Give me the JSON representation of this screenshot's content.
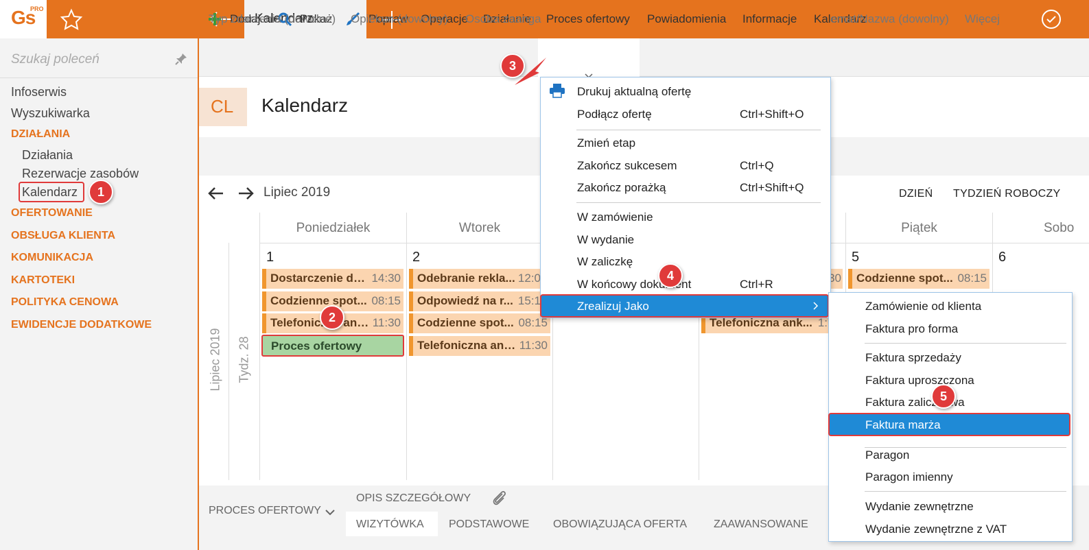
{
  "app": {
    "logo": "Gs",
    "logo_badge": "PRO",
    "active_tab": "Kalendarz"
  },
  "sidebar": {
    "search_placeholder": "Szukaj poleceń",
    "items": [
      {
        "label": "Infoserwis"
      },
      {
        "label": "Wyszukiwarka"
      }
    ],
    "groups": [
      {
        "label": "DZIAŁANIA"
      },
      {
        "label": "OFERTOWANIE"
      },
      {
        "label": "OBSŁUGA KLIENTA"
      },
      {
        "label": "KOMUNIKACJA"
      },
      {
        "label": "KARTOTEKI"
      },
      {
        "label": "POLITYKA CENOWA"
      },
      {
        "label": "EWIDENCJE DODATKOWE"
      }
    ],
    "subitems": [
      {
        "label": "Działania"
      },
      {
        "label": "Rezerwacje zasobów"
      },
      {
        "label": "Kalendarz"
      }
    ]
  },
  "toolbar": {
    "add": "Dodaj",
    "show": "Pokaż",
    "edit": "Popraw",
    "operations": "Operacje",
    "actions": "Działanie",
    "offer_process": "Proces ofertowy",
    "notifications": "Powiadomienia",
    "info": "Informacje",
    "calendar": "Kalendarz"
  },
  "page": {
    "badge": "CL",
    "title": "Kalendarz"
  },
  "filters": [
    "Typ zdarzenia (dowolne)",
    "Opiekun (dowolny)",
    "Osoba zaanga",
    "emat/Nazwa (dowolny)",
    "Więcej"
  ],
  "calendar": {
    "month": "Lipiec 2019",
    "view_day": "DZIEŃ",
    "view_workweek": "TYDZIEŃ ROBOCZY",
    "side_month": "Lipiec 2019",
    "side_week": "Tydz. 28",
    "days": [
      {
        "name": "Poniedziałek",
        "num": "1"
      },
      {
        "name": "Wtorek",
        "num": "2"
      },
      {
        "name": "Piątek",
        "num": "5"
      },
      {
        "name": "Sobo",
        "num": "6"
      }
    ],
    "monday_events": [
      {
        "title": "Dostarczenie du...",
        "time": "14:30"
      },
      {
        "title": "Codzienne spot...",
        "time": "08:15"
      },
      {
        "title": "Telefoniczna ank...",
        "time": "11:30"
      }
    ],
    "monday_selected_event": "Proces ofertowy",
    "tuesday_events": [
      {
        "title": "Odebranie rekla...",
        "time": "12:0"
      },
      {
        "title": "Odpowiedź na r...",
        "time": "15:1"
      },
      {
        "title": "Codzienne spot...",
        "time": "08:15"
      },
      {
        "title": "Telefoniczna ank...",
        "time": "11:30"
      }
    ],
    "thursday_partial": [
      {
        "time": "30"
      },
      {
        "title": "Telefoniczna ank...",
        "time": "1:"
      }
    ],
    "friday_events": [
      {
        "title": "Codzienne spot...",
        "time": "08:15"
      }
    ]
  },
  "bottom": {
    "section": "PROCES OFERTOWY",
    "detail_tab": "OPIS SZCZEGÓŁOWY",
    "tabs": [
      "WIZYTÓWKA",
      "PODSTAWOWE",
      "OBOWIĄZUJĄCA OFERTA",
      "ZAAWANSOWANE"
    ]
  },
  "menu": {
    "print_offer": "Drukuj aktualną ofertę",
    "attach_offer": "Podłącz ofertę",
    "attach_offer_sc": "Ctrl+Shift+O",
    "change_stage": "Zmień etap",
    "finish_success": "Zakończ sukcesem",
    "finish_success_sc": "Ctrl+Q",
    "finish_fail": "Zakończ porażką",
    "finish_fail_sc": "Ctrl+Shift+Q",
    "to_order": "W zamówienie",
    "to_issue": "W wydanie",
    "to_advance": "W zaliczkę",
    "to_final": "W końcowy dokument",
    "to_final_sc": "Ctrl+R",
    "realize_as": "Zrealizuj Jako"
  },
  "submenu": [
    "Zamówienie od klienta",
    "Faktura pro forma",
    "Faktura sprzedaży",
    "Faktura uproszczona",
    "Faktura zaliczkowa",
    "Faktura marża",
    "Paragon",
    "Paragon imienny",
    "Wydanie zewnętrzne",
    "Wydanie zewnętrzne z VAT"
  ],
  "annotations": [
    "1",
    "2",
    "3",
    "4",
    "5"
  ],
  "colors": {
    "accent": "#e5731e",
    "selection": "#1f8ad6",
    "annotation": "#e03a3a",
    "event": "#fbd5b0",
    "event_green": "#a8d5a2"
  }
}
